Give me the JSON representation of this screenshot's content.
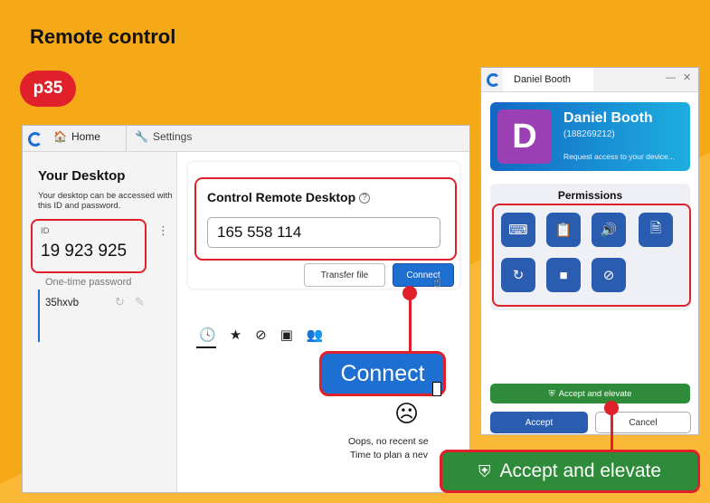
{
  "page": {
    "title": "Remote control",
    "page_ref": "p35",
    "accent_color": "#f6a917",
    "highlight_color": "#e0202a"
  },
  "main_window": {
    "tabs": [
      {
        "label": "Home",
        "icon": "home-icon"
      },
      {
        "label": "Settings",
        "icon": "wrench-icon"
      }
    ],
    "sidebar": {
      "title": "Your Desktop",
      "description": "Your desktop can be accessed with this ID and password.",
      "id_label": "ID",
      "id_value": "19 923 925",
      "otp_label": "One-time password",
      "otp_value": "35hxvb"
    },
    "control": {
      "title": "Control Remote Desktop",
      "remote_id": "165 558 114",
      "transfer_label": "Transfer file",
      "connect_label": "Connect"
    },
    "recents": {
      "empty_line1": "Oops, no recent se",
      "empty_line2": "Time to plan a nev"
    }
  },
  "callouts": {
    "connect_label": "Connect",
    "elevate_label": "Accept and elevate"
  },
  "prompt_window": {
    "tab_title": "Daniel Booth",
    "user": {
      "initial": "D",
      "name": "Daniel Booth",
      "id": "(188269212)",
      "request": "Request access to your device..."
    },
    "permissions_title": "Permissions",
    "elevate_label": "Accept and elevate",
    "accept_label": "Accept",
    "cancel_label": "Cancel"
  },
  "glyphs": {
    "home": "🏠",
    "wrench": "🔧",
    "help": "?",
    "kebab": "⋮",
    "refresh": "↻",
    "edit": "✎",
    "clock": "🕓",
    "star": "★",
    "compass": "⊘",
    "contact": "▣",
    "people": "👥",
    "sad": "☹",
    "minimize": "—",
    "close": "✕",
    "shield": "⛨",
    "keyboard": "⌨",
    "clipboard": "📋",
    "sound": "🔊",
    "file": "🗎",
    "restart": "↻",
    "camera": "■",
    "block": "⊘"
  }
}
